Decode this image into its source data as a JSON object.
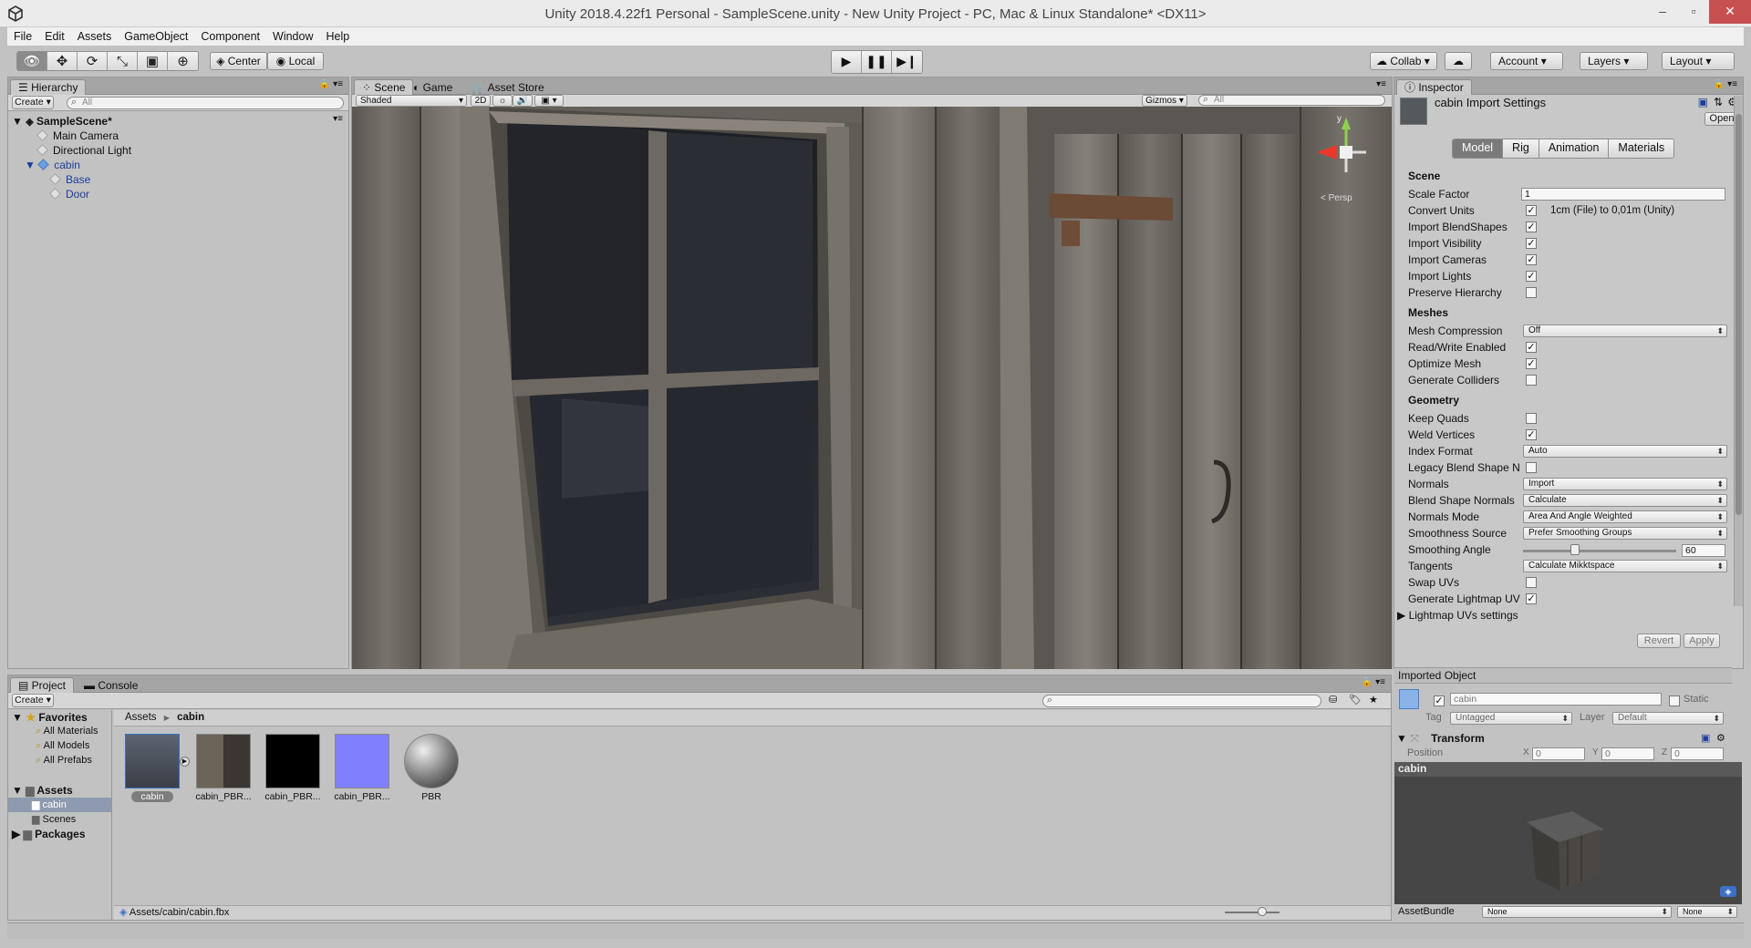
{
  "window": {
    "title": "Unity 2018.4.22f1 Personal - SampleScene.unity - New Unity Project - PC, Mac & Linux Standalone* <DX11>"
  },
  "menu": [
    "File",
    "Edit",
    "Assets",
    "GameObject",
    "Component",
    "Window",
    "Help"
  ],
  "toolbar": {
    "pivot": "Center",
    "space": "Local",
    "collab": "Collab",
    "account": "Account",
    "layers": "Layers",
    "layout": "Layout"
  },
  "hierarchy": {
    "tab": "Hierarchy",
    "create": "Create",
    "search_placeholder": "All",
    "scene": "SampleScene*",
    "items": [
      "Main Camera",
      "Directional Light",
      "cabin",
      "Base",
      "Door"
    ]
  },
  "scene_tabs": {
    "scene": "Scene",
    "game": "Game",
    "asset_store": "Asset Store",
    "shading": "Shaded",
    "mode2d": "2D",
    "gizmos": "Gizmos",
    "search_placeholder": "All",
    "persp": "< Persp",
    "axis_y": "y"
  },
  "inspector": {
    "tab": "Inspector",
    "title": "cabin Import Settings",
    "open": "Open",
    "tabs": [
      "Model",
      "Rig",
      "Animation",
      "Materials"
    ],
    "section_scene": "Scene",
    "scale_factor_label": "Scale Factor",
    "scale_factor_value": "1",
    "convert_units_label": "Convert Units",
    "convert_units_note": "1cm (File) to 0,01m (Unity)",
    "import_blendshapes": "Import BlendShapes",
    "import_visibility": "Import Visibility",
    "import_cameras": "Import Cameras",
    "import_lights": "Import Lights",
    "preserve_hierarchy": "Preserve Hierarchy",
    "section_meshes": "Meshes",
    "mesh_compression_label": "Mesh Compression",
    "mesh_compression_value": "Off",
    "read_write": "Read/Write Enabled",
    "optimize_mesh": "Optimize Mesh",
    "generate_colliders": "Generate Colliders",
    "section_geometry": "Geometry",
    "keep_quads": "Keep Quads",
    "weld_vertices": "Weld Vertices",
    "index_format_label": "Index Format",
    "index_format_value": "Auto",
    "legacy_blend": "Legacy Blend Shape N",
    "normals_label": "Normals",
    "normals_value": "Import",
    "blend_normals_label": "Blend Shape Normals",
    "blend_normals_value": "Calculate",
    "normals_mode_label": "Normals Mode",
    "normals_mode_value": "Area And Angle Weighted",
    "smoothness_source_label": "Smoothness Source",
    "smoothness_source_value": "Prefer Smoothing Groups",
    "smoothing_angle_label": "Smoothing Angle",
    "smoothing_angle_value": "60",
    "smoothing_angle_fraction": 0.33,
    "tangents_label": "Tangents",
    "tangents_value": "Calculate Mikktspace",
    "swap_uvs": "Swap UVs",
    "generate_lightmap": "Generate Lightmap UV",
    "lightmap_settings": "Lightmap UVs settings",
    "revert": "Revert",
    "apply": "Apply",
    "imported_object": "Imported Object",
    "obj_name": "cabin",
    "static": "Static",
    "tag_label": "Tag",
    "tag_value": "Untagged",
    "layer_label": "Layer",
    "layer_value": "Default",
    "transform": "Transform",
    "position": "Position",
    "pos_x_label": "X",
    "pos_x": "0",
    "pos_y_label": "Y",
    "pos_y": "0",
    "pos_z_label": "Z",
    "pos_z": "0",
    "preview_title": "cabin",
    "assetbundle_label": "AssetBundle",
    "assetbundle_value": "None",
    "assetbundle_variant": "None"
  },
  "project": {
    "tab": "Project",
    "console": "Console",
    "create": "Create",
    "favorites": "Favorites",
    "fav_items": [
      "All Materials",
      "All Models",
      "All Prefabs"
    ],
    "assets": "Assets",
    "asset_folders": [
      "cabin",
      "Scenes"
    ],
    "packages": "Packages",
    "breadcrumb_root": "Assets",
    "breadcrumb_sep": "▶",
    "breadcrumb_current": "cabin",
    "files": [
      "cabin",
      "cabin_PBR...",
      "cabin_PBR...",
      "cabin_PBR...",
      "PBR"
    ],
    "status_path": "Assets/cabin/cabin.fbx"
  },
  "colors": {
    "accent_selected": "#3d6fc6",
    "panel_bg": "#c2c2c2",
    "normal_map": "#8080ff"
  }
}
